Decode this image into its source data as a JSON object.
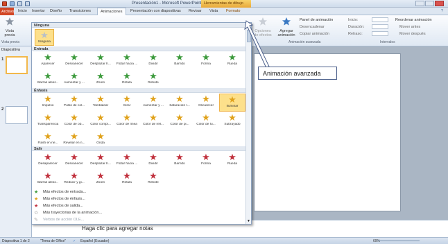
{
  "window": {
    "title": "Presentación1 - Microsoft PowerPoint",
    "context_tab_group": "Herramientas de dibujo"
  },
  "tabs": [
    "Archivo",
    "Inicio",
    "Insertar",
    "Diseño",
    "Transiciones",
    "Animaciones",
    "Presentación con diapositivas",
    "Revisar",
    "Vista",
    "Formato"
  ],
  "ribbon": {
    "vista_previa": "Vista previa",
    "vista_previa_group": "Vista previa",
    "opciones_efectos": "Opciones de efectos",
    "agregar_animacion": "Agregar animación",
    "panel_animacion": "Panel de animación",
    "desencadenar": "Desencadenar",
    "copiar_animacion": "Copiar animación",
    "group_anim_avanzada": "Animación avanzada",
    "inicio": "Inicio:",
    "duracion": "Duración:",
    "retraso": "Retraso:",
    "group_intervalos": "Intervalos",
    "reordenar": "Reordenar animación",
    "mover_antes": "Mover antes",
    "mover_despues": "Mover después"
  },
  "gallery": {
    "ninguna_header": "Ninguna",
    "ninguna_item": "Ninguna",
    "entrada_header": "Entrada",
    "entrada": [
      "Aparecer",
      "Desvanecer",
      "Desplazar h...",
      "Flotar hacia ...",
      "Dividir",
      "Barrido",
      "Forma",
      "Rueda",
      "Barras aleat...",
      "Aumentar y ...",
      "Zoom",
      "Rótula",
      "Rebote"
    ],
    "enfasis_header": "Énfasis",
    "enfasis": [
      "Impulso",
      "Pulso de col...",
      "Tambalear",
      "Girar",
      "Aumentar y ...",
      "Saturación r...",
      "Oscurecer",
      "Iluminar",
      "Transparencia",
      "Color de ob...",
      "Color compl...",
      "Color de línea",
      "Color de rell...",
      "Color de pi...",
      "Color de fu...",
      "Subrayado",
      "Flash en ne...",
      "Revelar en n...",
      "Onda"
    ],
    "salir_header": "Salir",
    "salir": [
      "Desaparecer",
      "Desvanecer",
      "Desplazar h...",
      "Flotar hacia ...",
      "Dividir",
      "Barrido",
      "Forma",
      "Rueda",
      "Barras aleat...",
      "Reducir y gi...",
      "Zoom",
      "Rótula",
      "Rebote"
    ],
    "more": [
      "Más efectos de entrada...",
      "Más efectos de énfasis...",
      "Más efectos de salida...",
      "Más trayectorias de la animación...",
      "Verbos de acción OLE..."
    ]
  },
  "slides_panel": {
    "label": "Diapositiva",
    "numbers": [
      "1",
      "2"
    ]
  },
  "notes": {
    "placeholder": "Haga clic para agregar notas"
  },
  "status": {
    "slide": "Diapositiva 1 de 2",
    "theme": "\"Tema de Office\"",
    "language": "Español (Ecuador)",
    "zoom": "69%"
  },
  "callout": {
    "text": "Animación avanzada"
  },
  "colors": {
    "entrada": "#3c9a3c",
    "enfasis": "#e0a21c",
    "salir": "#c0303c",
    "selected": "#fde08b"
  }
}
